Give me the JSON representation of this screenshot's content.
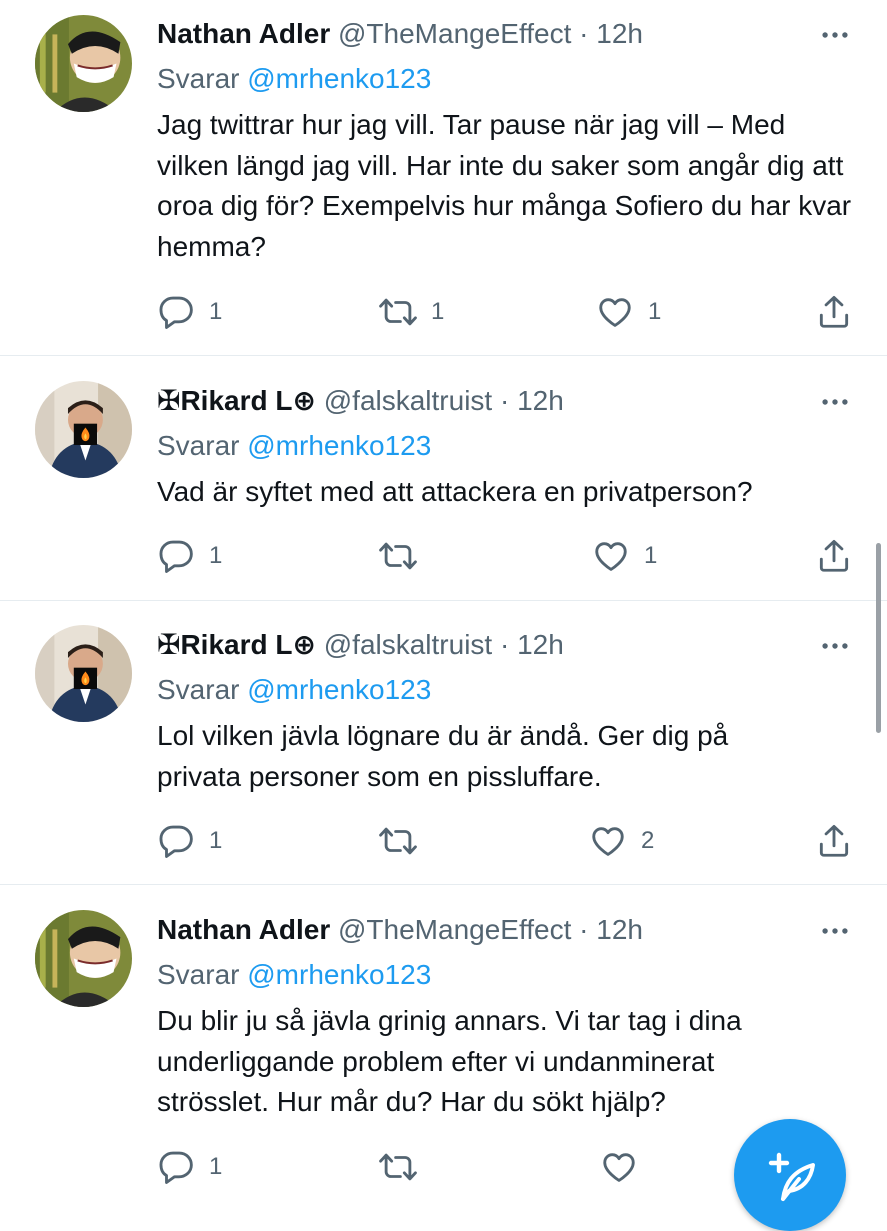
{
  "tweets": [
    {
      "name": "Nathan Adler",
      "handle": "@TheMangeEffect",
      "time": "12h",
      "replying_prefix": "Svarar",
      "replying_to": "@mrhenko123",
      "text": "Jag twittrar hur jag vill. Tar pause när jag vill – Med vilken längd jag vill. Har inte du saker som angår dig att oroa dig för? Exempelvis hur många Sofiero du har kvar hemma?",
      "replies": "1",
      "retweets": "1",
      "likes": "1"
    },
    {
      "name": "✠Rikard L⊕",
      "handle": "@falskaltruist",
      "time": "12h",
      "replying_prefix": "Svarar",
      "replying_to": "@mrhenko123",
      "text": "Vad är syftet med att attackera en privatperson?",
      "replies": "1",
      "retweets": "",
      "likes": "1"
    },
    {
      "name": "✠Rikard L⊕",
      "handle": "@falskaltruist",
      "time": "12h",
      "replying_prefix": "Svarar",
      "replying_to": "@mrhenko123",
      "text": "Lol vilken jävla lögnare du är ändå. Ger dig på privata personer som en pissluffare.",
      "replies": "1",
      "retweets": "",
      "likes": "2"
    },
    {
      "name": "Nathan Adler",
      "handle": "@TheMangeEffect",
      "time": "12h",
      "replying_prefix": "Svarar",
      "replying_to": "@mrhenko123",
      "text": "Du blir ju så jävla grinig annars. Vi tar tag i dina underliggande problem efter vi undanminerat strösslet. Hur mår du? Har du sökt hjälp?",
      "replies": "1",
      "retweets": "",
      "likes": ""
    }
  ],
  "separator": "·",
  "colors": {
    "accent": "#1d9bf0",
    "secondary_text": "#536471",
    "divider": "#e6ecf0"
  },
  "icons": [
    "reply-icon",
    "retweet-icon",
    "like-icon",
    "share-icon",
    "more-icon",
    "compose-tweet-icon",
    "avatar-nathan-adler",
    "avatar-rikard-l",
    "fire-emoji"
  ]
}
